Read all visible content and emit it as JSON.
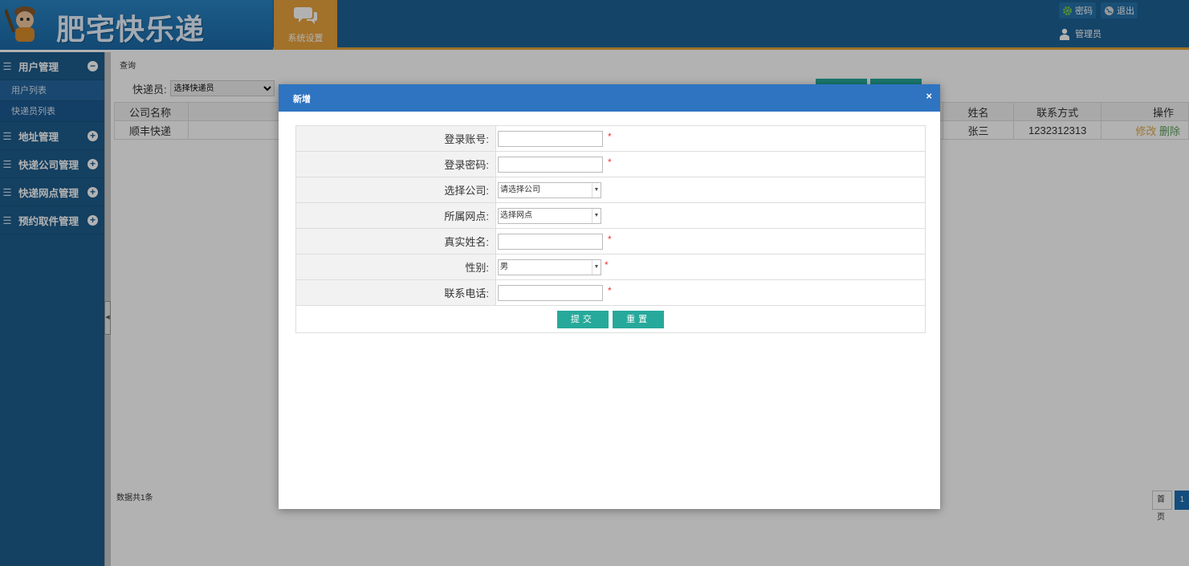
{
  "header": {
    "logo_text": "肥宅快乐递",
    "system_tab": "系统设置",
    "links": [
      {
        "label": "密码",
        "icon": "gear-icon"
      },
      {
        "label": "退出",
        "icon": "globe-icon"
      }
    ],
    "user": "管理员"
  },
  "sidebar": {
    "groups": [
      {
        "label": "用户管理",
        "toggle": "−",
        "subs": [
          "用户列表",
          "快递员列表"
        ]
      },
      {
        "label": "地址管理",
        "toggle": "+"
      },
      {
        "label": "快递公司管理",
        "toggle": "+"
      },
      {
        "label": "快递网点管理",
        "toggle": "+"
      },
      {
        "label": "预约取件管理",
        "toggle": "+"
      }
    ]
  },
  "content": {
    "breadcrumb": "查询",
    "filter_label": "快递员:",
    "filter_value": "选择快递员",
    "grid": {
      "left_headers": [
        "公司名称"
      ],
      "right_headers": [
        "姓名",
        "联系方式",
        "操作"
      ],
      "row": {
        "company": "顺丰快递",
        "name": "张三",
        "phone": "1232312313",
        "edit": "修改",
        "delete": "删除"
      }
    },
    "total": "数据共1条",
    "pager": {
      "first": "首页",
      "current": "1"
    }
  },
  "modal": {
    "title": "新增",
    "close": "×",
    "fields": [
      {
        "label": "登录账号:",
        "type": "input",
        "required": true
      },
      {
        "label": "登录密码:",
        "type": "input",
        "required": true
      },
      {
        "label": "选择公司:",
        "type": "select",
        "value": "请选择公司",
        "required": false
      },
      {
        "label": "所属网点:",
        "type": "select",
        "value": "选择网点",
        "required": false
      },
      {
        "label": "真实姓名:",
        "type": "input",
        "required": true
      },
      {
        "label": "性别:",
        "type": "select",
        "value": "男",
        "required": true
      },
      {
        "label": "联系电话:",
        "type": "input",
        "required": true
      }
    ],
    "required_mark": "*",
    "submit": "提交",
    "reset": "重置"
  },
  "colors": {
    "header": "#1e6295",
    "accent": "#e8a33d",
    "modal_head": "#2e74c1",
    "button": "#26a99b"
  }
}
